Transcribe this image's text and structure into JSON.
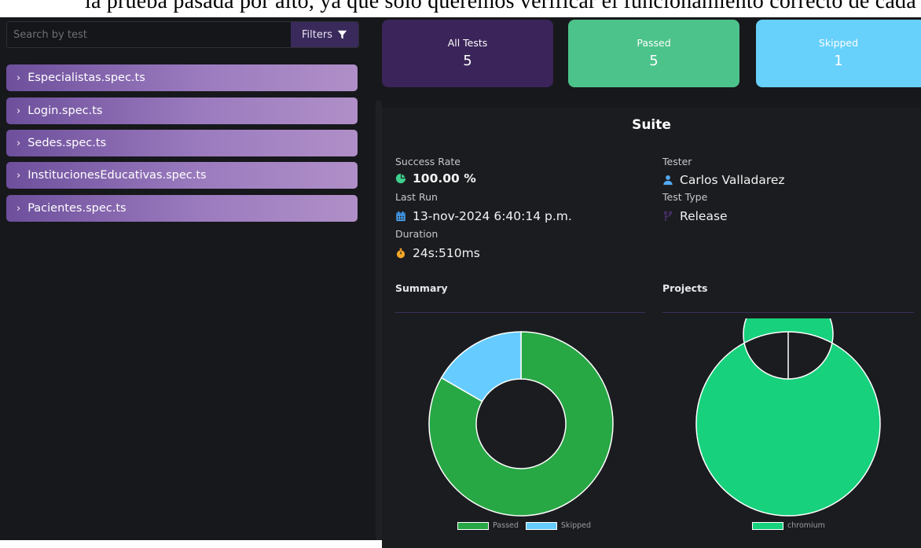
{
  "caption": "la prueba pasada por alto, ya que solo queremos verificar el funcionamiento correcto de cada una de las pruebas",
  "search": {
    "placeholder": "Search by test"
  },
  "filters_label": "Filters",
  "specs": [
    {
      "label": "Especialistas.spec.ts"
    },
    {
      "label": "Login.spec.ts"
    },
    {
      "label": "Sedes.spec.ts"
    },
    {
      "label": "InstitucionesEducativas.spec.ts"
    },
    {
      "label": "Pacientes.spec.ts"
    }
  ],
  "cards": {
    "all": {
      "title": "All Tests",
      "value": "5",
      "color": "#3a2459"
    },
    "passed": {
      "title": "Passed",
      "value": "5",
      "color": "#4cc38a"
    },
    "skipped": {
      "title": "Skipped",
      "value": "1",
      "color": "#67d0fb"
    }
  },
  "suite": {
    "title": "Suite",
    "success_rate_label": "Success Rate",
    "success_rate_value": "100.00 %",
    "last_run_label": "Last Run",
    "last_run_value": "13-nov-2024 6:40:14 p.m.",
    "duration_label": "Duration",
    "duration_value": "24s:510ms",
    "tester_label": "Tester",
    "tester_value": "Carlos Valladarez",
    "test_type_label": "Test Type",
    "test_type_value": "Release",
    "icons": [
      "chart-pie-icon",
      "calendar-icon",
      "stopwatch-icon",
      "user-icon",
      "branch-icon"
    ]
  },
  "summary_label": "Summary",
  "projects_label": "Projects",
  "chart_data": [
    {
      "type": "pie",
      "donut": true,
      "categories": [
        "Passed",
        "Skipped"
      ],
      "values": [
        5,
        1
      ],
      "colors": [
        "#28a745",
        "#66ccff"
      ],
      "legend": "bottom"
    },
    {
      "type": "pie",
      "donut": true,
      "categories": [
        "chromium"
      ],
      "values": [
        5
      ],
      "colors": [
        "#17d17c"
      ],
      "legend": "bottom"
    }
  ]
}
